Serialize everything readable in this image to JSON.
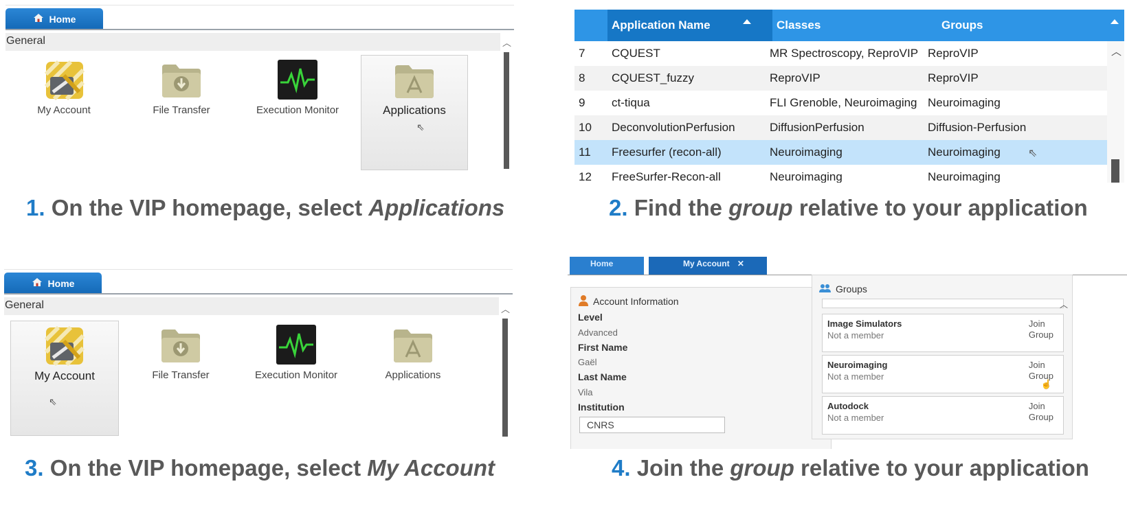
{
  "step1": {
    "tab_label": "Home",
    "section_title": "General",
    "tiles": [
      "My Account",
      "File Transfer",
      "Execution Monitor",
      "Applications"
    ],
    "selected_tile": "Applications",
    "caption_num": "1.",
    "caption_text": " On the VIP homepage, select ",
    "caption_em": "Applications"
  },
  "step2": {
    "headers": [
      "Application Name",
      "Classes",
      "Groups"
    ],
    "rows": [
      {
        "id": "7",
        "name": "CQUEST",
        "classes": "MR Spectroscopy, ReproVIP",
        "groups": "ReproVIP"
      },
      {
        "id": "8",
        "name": "CQUEST_fuzzy",
        "classes": "ReproVIP",
        "groups": "ReproVIP"
      },
      {
        "id": "9",
        "name": "ct-tiqua",
        "classes": "FLI Grenoble, Neuroimaging",
        "groups": "Neuroimaging"
      },
      {
        "id": "10",
        "name": "DeconvolutionPerfusion",
        "classes": "DiffusionPerfusion",
        "groups": "Diffusion-Perfusion"
      },
      {
        "id": "11",
        "name": "Freesurfer (recon-all)",
        "classes": "Neuroimaging",
        "groups": "Neuroimaging"
      },
      {
        "id": "12",
        "name": "FreeSurfer-Recon-all",
        "classes": "Neuroimaging",
        "groups": "Neuroimaging"
      }
    ],
    "highlight_color": "#c3e3fb",
    "header_color": "#2e95e6",
    "caption_num": "2.",
    "caption_pre": " Find the ",
    "caption_em": "group",
    "caption_post": " relative to your application"
  },
  "step3": {
    "tab_label": "Home",
    "section_title": "General",
    "tiles": [
      "My Account",
      "File Transfer",
      "Execution Monitor",
      "Applications"
    ],
    "selected_tile": "My Account",
    "caption_num": "3.",
    "caption_text": " On the VIP homepage, select ",
    "caption_em": "My Account"
  },
  "step4": {
    "tabs": [
      "Home",
      "My Account"
    ],
    "account_title": "Account Information",
    "fields": [
      {
        "label": "Level",
        "value": "Advanced"
      },
      {
        "label": "First Name",
        "value": "Gaël"
      },
      {
        "label": "Last Name",
        "value": "Vila"
      }
    ],
    "institution_label": "Institution",
    "institution_value": "CNRS",
    "groups_title": "Groups",
    "groups": [
      {
        "name": "Image Simulators",
        "status": "Not a member",
        "join_line1": "Join",
        "join_line2": "Group"
      },
      {
        "name": "Neuroimaging",
        "status": "Not a member",
        "join_line1": "Join",
        "join_line2": "Group"
      },
      {
        "name": "Autodock",
        "status": "Not a member",
        "join_line1": "Join",
        "join_line2": "Group"
      }
    ],
    "caption_num": "4.",
    "caption_pre": " Join the ",
    "caption_em": "group",
    "caption_post": " relative to your application"
  },
  "colors": {
    "accent": "#1f7cc7",
    "caption_gray": "#595959",
    "tab_blue": "#1469b7"
  }
}
